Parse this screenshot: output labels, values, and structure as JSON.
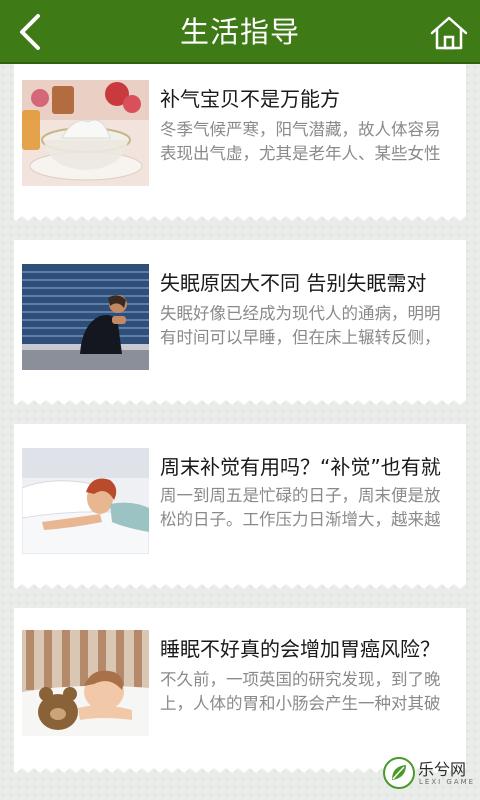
{
  "header": {
    "title": "生活指导",
    "back_icon": "chevron-left-icon",
    "home_icon": "home-icon",
    "background_color": "#3e7a15"
  },
  "articles": [
    {
      "title": "补气宝贝不是万能方",
      "summary": "冬季气候严寒，阳气潜藏，故人体容易表现出气虚，尤其是老年人、某些女性",
      "image": "bird-nest-dessert-image"
    },
    {
      "title": "失眠原因大不同 告别失眠需对",
      "summary": "失眠好像已经成为现代人的通病，明明有时间可以早睡，但在床上辗转反侧，",
      "image": "insomnia-man-image"
    },
    {
      "title": "周末补觉有用吗？“补觉”也有就",
      "summary": "周一到周五是忙碌的日子，周末便是放松的日子。工作压力日渐增大，越来越",
      "image": "sleeping-woman-image"
    },
    {
      "title": "睡眠不好真的会增加胃癌风险？",
      "summary": "不久前，一项英国的研究发现，到了晚上，人体的胃和小肠会产生一种对其破",
      "image": "sleeping-child-image"
    }
  ],
  "watermark": {
    "text": "乐兮网",
    "subtext": "LEXI GAME"
  }
}
